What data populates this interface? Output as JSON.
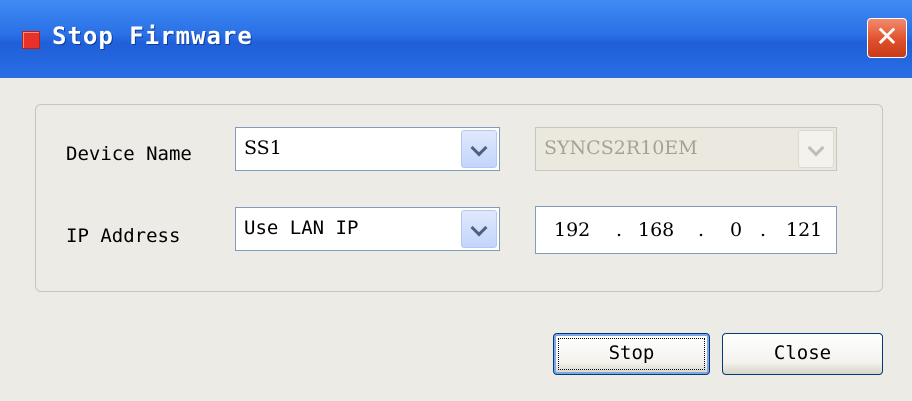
{
  "window": {
    "title": "Stop Firmware",
    "icon": "app-icon",
    "close_label": "✕"
  },
  "form": {
    "device_name_label": "Device Name",
    "device_name_value": "SS1",
    "model_value": "SYNCS2R10EM",
    "ip_address_label": "IP Address",
    "ip_mode_value": "Use LAN IP",
    "ip_octets": [
      "192",
      "168",
      "0",
      "121"
    ],
    "ip_separator": "."
  },
  "buttons": {
    "stop_label": "Stop",
    "close_label": "Close"
  },
  "colors": {
    "titlebar": "#2a6fe6",
    "client_bg": "#ecebe5",
    "close_button": "#e0502c"
  }
}
